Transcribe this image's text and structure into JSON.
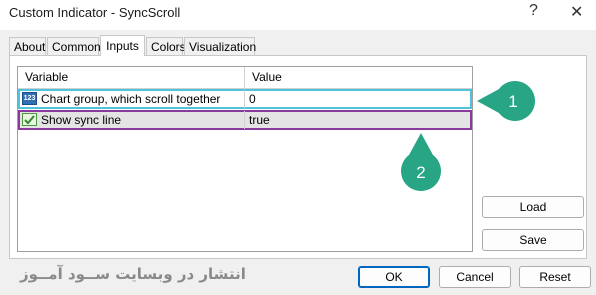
{
  "window": {
    "title": "Custom Indicator - SyncScroll",
    "help_glyph": "?",
    "close_glyph": "✕"
  },
  "tabs": [
    {
      "label": "About"
    },
    {
      "label": "Common"
    },
    {
      "label": "Inputs",
      "active": true
    },
    {
      "label": "Colors"
    },
    {
      "label": "Visualization"
    }
  ],
  "grid": {
    "headers": {
      "variable": "Variable",
      "value": "Value"
    },
    "rows": [
      {
        "icon": "numeric-123-icon",
        "icon_text": "123",
        "name": "Chart group, which scroll together",
        "value": "0",
        "highlight": "#4fc3dc"
      },
      {
        "icon": "boolean-checkmark-icon",
        "name": "Show sync line",
        "value": "true",
        "highlight": "#8a3a9e"
      }
    ]
  },
  "side_buttons": {
    "load": "Load",
    "save": "Save"
  },
  "footer_buttons": {
    "ok": "OK",
    "cancel": "Cancel",
    "reset": "Reset"
  },
  "annotations": [
    {
      "number": "1",
      "color": "#27a584"
    },
    {
      "number": "2",
      "color": "#27a584"
    }
  ],
  "watermark": "انتشار در وبسایت ســود آمــوز"
}
